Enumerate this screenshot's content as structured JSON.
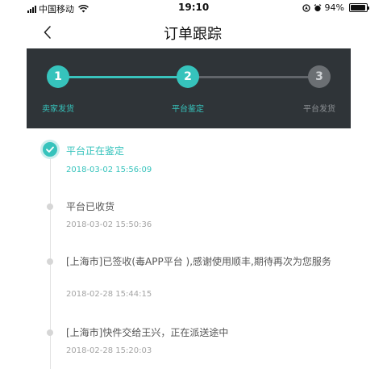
{
  "status_bar": {
    "carrier": "中国移动",
    "time": "19:10",
    "battery_percent": "94%",
    "battery_level": 0.94,
    "icons": [
      "signal-icon",
      "wifi-icon",
      "location-icon",
      "alarm-icon",
      "battery-icon"
    ]
  },
  "nav": {
    "title": "订单跟踪",
    "back_icon": "chevron-left-icon"
  },
  "steps": [
    {
      "number": "1",
      "label": "卖家发货",
      "state": "done"
    },
    {
      "number": "2",
      "label": "平台鉴定",
      "state": "current"
    },
    {
      "number": "3",
      "label": "平台发货",
      "state": "pending"
    }
  ],
  "timeline": [
    {
      "text": "平台正在鉴定",
      "time": "2018-03-02 15:56:09",
      "active": true
    },
    {
      "text": "平台已收货",
      "time": "2018-03-02 15:50:36",
      "active": false
    },
    {
      "text": "[上海市]已签收(毒APP平台 ),感谢使用顺丰,期待再次为您服务",
      "time": "2018-02-28 15:44:15",
      "active": false
    },
    {
      "text": "[上海市]快件交给王兴，正在派送途中",
      "time": "2018-02-28 15:20:03",
      "active": false
    }
  ],
  "colors": {
    "accent": "#36c3bc",
    "panel_bg": "#2f3438",
    "pending": "#6b6f73"
  }
}
